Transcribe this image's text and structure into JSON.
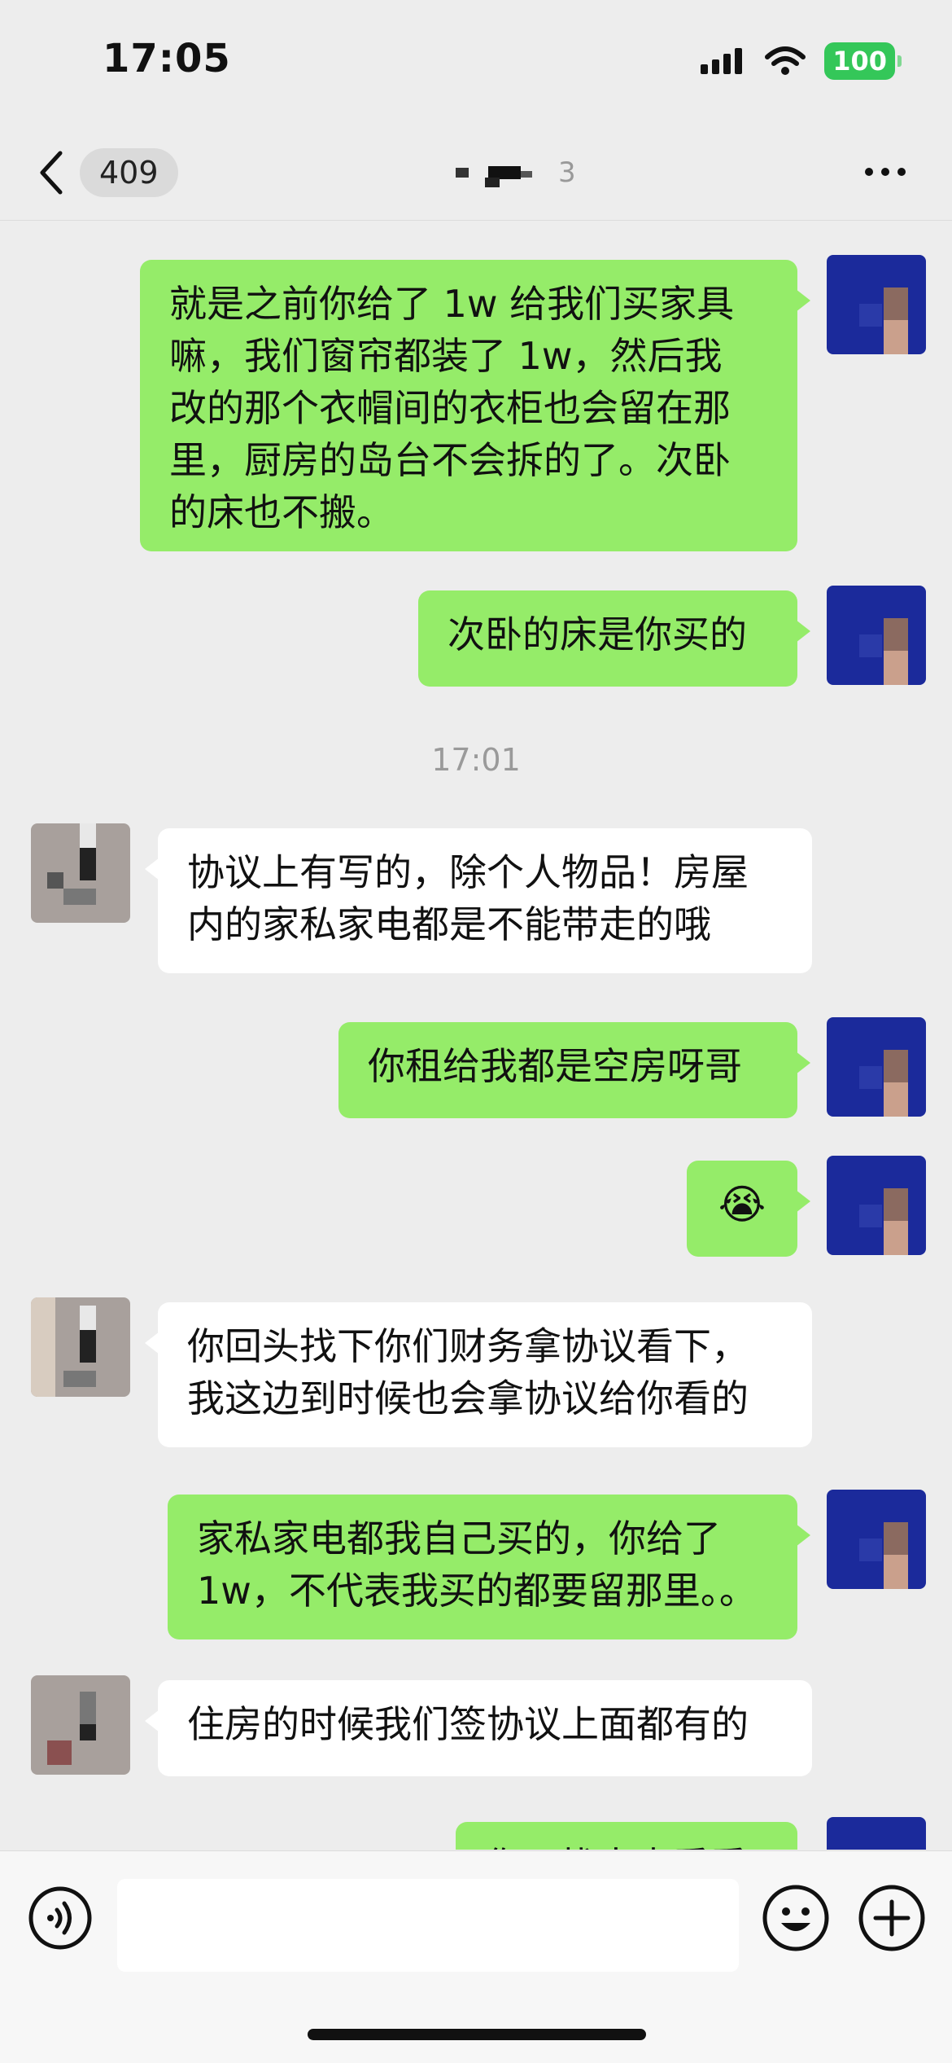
{
  "status_bar": {
    "time": "17:05",
    "battery": "100"
  },
  "nav": {
    "unread_count": "409",
    "title_glyph": "3"
  },
  "messages": [
    {
      "side": "sent",
      "text": "就是之前你给了 1w 给我们买家具\n嘛，我们窗帘都装了 1w，然后我\n改的那个衣帽间的衣柜也会留在那\n里，厨房的岛台不会拆的了。次卧\n的床也不搬。"
    },
    {
      "side": "sent",
      "text": "次卧的床是你买的"
    },
    {
      "timestamp": "17:01"
    },
    {
      "side": "recv",
      "text": "协议上有写的，除个人物品！房屋\n内的家私家电都是不能带走的哦"
    },
    {
      "side": "sent",
      "text": "你租给我都是空房呀哥"
    },
    {
      "side": "sent",
      "emoji": "😭"
    },
    {
      "side": "recv",
      "text": "你回头找下你们财务拿协议看下，\n我这边到时候也会拿协议给你看的"
    },
    {
      "side": "sent",
      "text": "家私家电都我自己买的，你给了\n1w，不代表我买的都要留那里。。"
    },
    {
      "side": "recv",
      "text": "住房的时候我们签协议上面都有的"
    },
    {
      "side": "sent",
      "text": "你可找出来看看"
    }
  ],
  "input": {
    "placeholder": ""
  },
  "icons": {
    "back": "chevron-left-icon",
    "more": "more-dots-icon",
    "voice": "voice-icon",
    "emoji": "emoji-icon",
    "plus": "plus-icon",
    "signal": "signal-icon",
    "wifi": "wifi-icon"
  }
}
